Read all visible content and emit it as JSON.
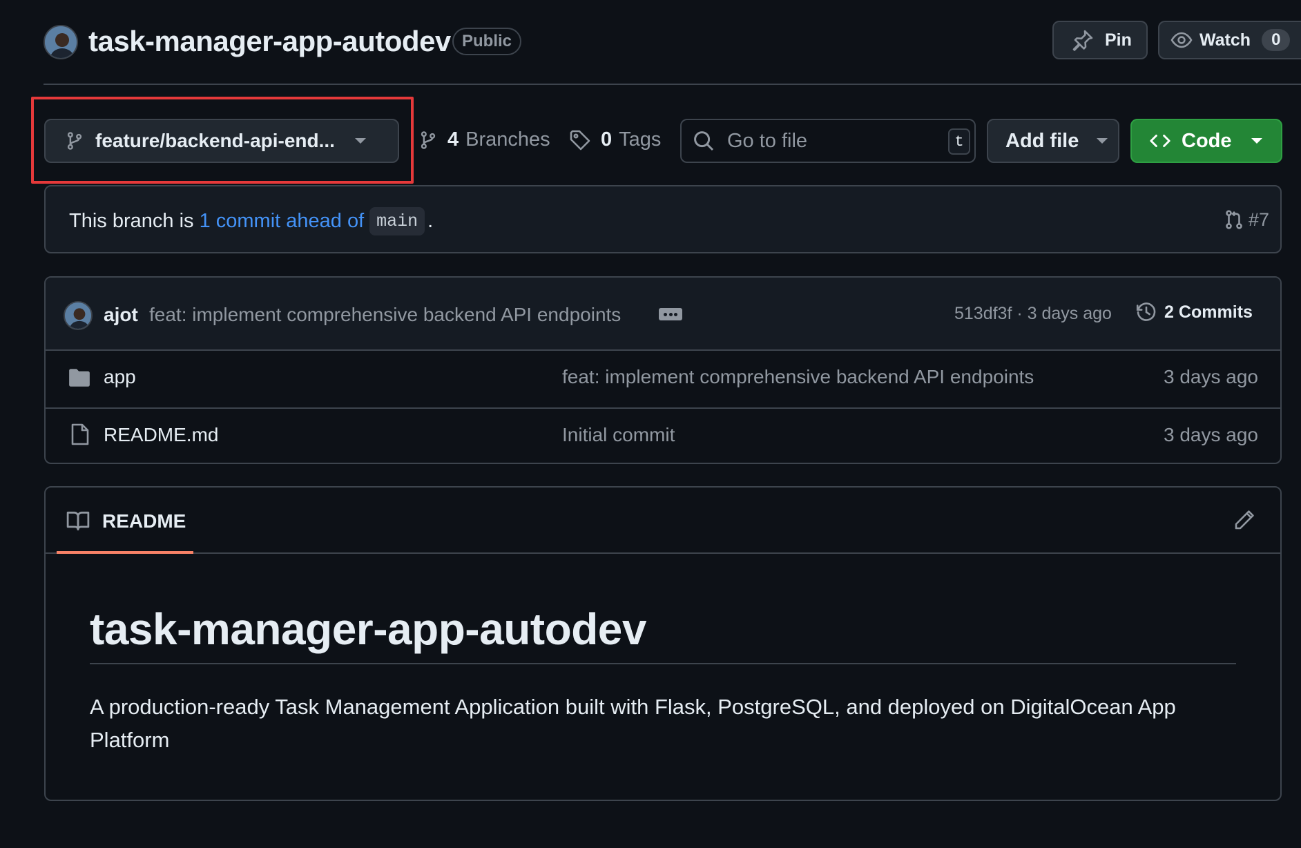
{
  "header": {
    "repo_name": "task-manager-app-autodev",
    "visibility": "Public",
    "pin_label": "Pin",
    "watch_label": "Watch",
    "watch_count": "0"
  },
  "toolbar": {
    "branch_name": "feature/backend-api-end...",
    "branches_count": "4",
    "branches_label": "Branches",
    "tags_count": "0",
    "tags_label": "Tags",
    "search_placeholder": "Go to file",
    "search_shortcut": "t",
    "add_file_label": "Add file",
    "code_label": "Code"
  },
  "ahead": {
    "prefix": "This branch is ",
    "link": "1 commit ahead of",
    "base_branch": "main",
    "suffix": ".",
    "pr_number": "#7"
  },
  "latest_commit": {
    "author": "ajot",
    "message": "feat: implement comprehensive backend API endpoints",
    "sha_age": "513df3f · 3 days ago",
    "commits_count": "2",
    "commits_label": "Commits"
  },
  "files": [
    {
      "name": "app",
      "type": "folder",
      "message": "feat: implement comprehensive backend API endpoints",
      "age": "3 days ago"
    },
    {
      "name": "README.md",
      "type": "file",
      "message": "Initial commit",
      "age": "3 days ago"
    }
  ],
  "readme": {
    "tab_label": "README",
    "title": "task-manager-app-autodev",
    "description": "A production-ready Task Management Application built with Flask, PostgreSQL, and deployed on DigitalOcean App Platform"
  },
  "colors": {
    "background": "#0d1117",
    "border": "#3d444d",
    "link": "#4493f8",
    "code_button": "#238636",
    "tab_underline": "#f78166",
    "highlight": "#e5393a"
  },
  "icons": [
    "avatar",
    "pin-icon",
    "eye-icon",
    "git-branch-icon",
    "tag-icon",
    "search-icon",
    "code-icon",
    "caret-down-icon",
    "git-pull-request-icon",
    "history-icon",
    "folder-icon",
    "file-icon",
    "book-icon",
    "pencil-icon"
  ]
}
